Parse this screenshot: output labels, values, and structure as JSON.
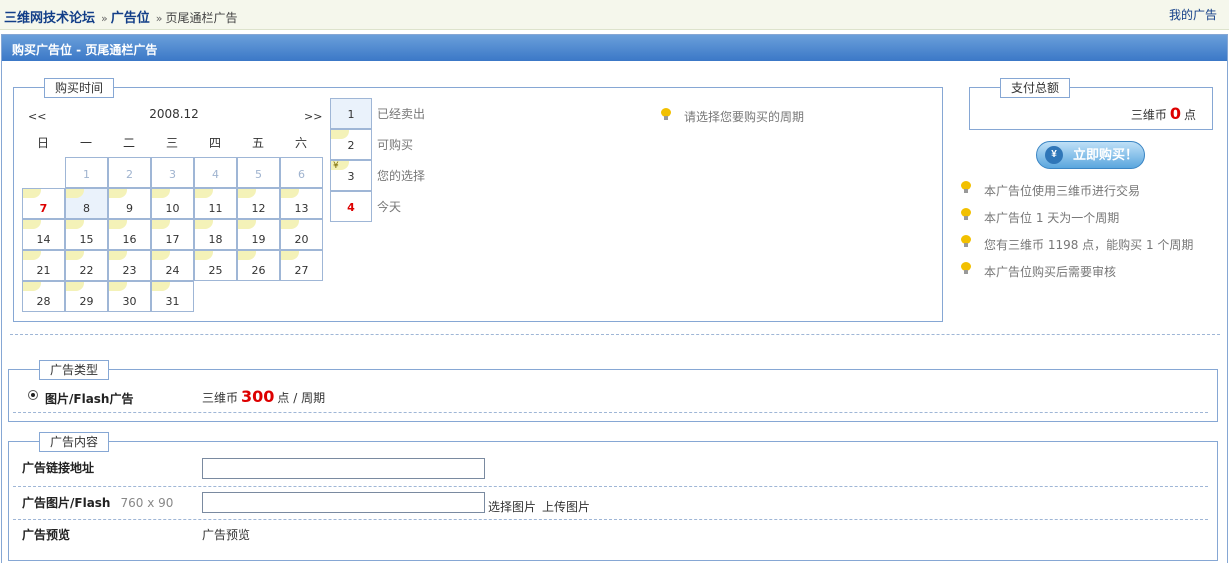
{
  "breadcrumb": {
    "forum": "三维网技术论坛",
    "ad_slot": "广告位",
    "current": "页尾通栏广告",
    "separator": "»"
  },
  "top_right_link": "我的广告",
  "panel_title": "购买广告位  - 页尾通栏广告",
  "purchase_time": {
    "legend": "购买时间",
    "prev": "<<",
    "next": ">>",
    "month": "2008.12",
    "weekdays": [
      "日",
      "一",
      "二",
      "三",
      "四",
      "五",
      "六"
    ],
    "days": [
      {
        "d": "1",
        "s": "past"
      },
      {
        "d": "2",
        "s": "past"
      },
      {
        "d": "3",
        "s": "past"
      },
      {
        "d": "4",
        "s": "past"
      },
      {
        "d": "5",
        "s": "past"
      },
      {
        "d": "6",
        "s": "past"
      },
      {
        "d": "7",
        "s": "today"
      },
      {
        "d": "8",
        "s": "selected"
      },
      {
        "d": "9",
        "s": "avail"
      },
      {
        "d": "10",
        "s": "avail"
      },
      {
        "d": "11",
        "s": "avail"
      },
      {
        "d": "12",
        "s": "avail"
      },
      {
        "d": "13",
        "s": "avail"
      },
      {
        "d": "14",
        "s": "avail"
      },
      {
        "d": "15",
        "s": "avail"
      },
      {
        "d": "16",
        "s": "avail"
      },
      {
        "d": "17",
        "s": "avail"
      },
      {
        "d": "18",
        "s": "avail"
      },
      {
        "d": "19",
        "s": "avail"
      },
      {
        "d": "20",
        "s": "avail"
      },
      {
        "d": "21",
        "s": "avail"
      },
      {
        "d": "22",
        "s": "avail"
      },
      {
        "d": "23",
        "s": "avail"
      },
      {
        "d": "24",
        "s": "avail"
      },
      {
        "d": "25",
        "s": "avail"
      },
      {
        "d": "26",
        "s": "avail"
      },
      {
        "d": "27",
        "s": "avail"
      },
      {
        "d": "28",
        "s": "avail"
      },
      {
        "d": "29",
        "s": "avail"
      },
      {
        "d": "30",
        "s": "avail"
      },
      {
        "d": "31",
        "s": "avail"
      }
    ],
    "legend_items": [
      {
        "num": "1",
        "label": "已经卖出"
      },
      {
        "num": "2",
        "label": "可购买"
      },
      {
        "num": "3",
        "label": "您的选择",
        "coin": "¥"
      },
      {
        "num": "4",
        "label": "今天"
      }
    ],
    "hint": "请选择您要购买的周期"
  },
  "payment": {
    "legend": "支付总额",
    "currency": "三维币",
    "amount": "0",
    "unit": "点",
    "buy_button": "立即购买！",
    "buy_icon": "yen-icon",
    "notes": [
      "本广告位使用三维币进行交易",
      "本广告位 1 天为一个周期",
      "您有三维币 1198 点，能购买 1 个周期",
      "本广告位购买后需要审核"
    ]
  },
  "ad_type": {
    "legend": "广告类型",
    "option_label": "图片/Flash广告",
    "price_prefix": "三维币",
    "price": "300",
    "price_suffix": "点 / 周期"
  },
  "ad_content": {
    "legend": "广告内容",
    "link_label": "广告链接地址",
    "link_value": "",
    "image_label": "广告图片/Flash",
    "image_size": "760 x 90",
    "image_value": "",
    "choose_image": "选择图片",
    "upload_image": "上传图片",
    "preview_label": "广告预览",
    "preview_value": "广告预览"
  },
  "colors": {
    "header_blue": "#3b78c7",
    "link_blue": "#123e88",
    "price_red": "#dd0000",
    "border_blue": "#86a7d4"
  }
}
